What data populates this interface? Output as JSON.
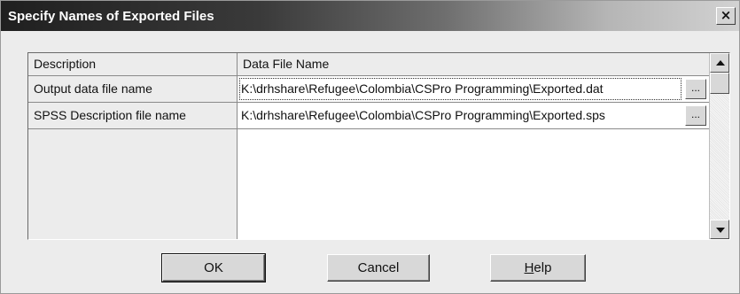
{
  "window": {
    "title": "Specify Names of Exported Files",
    "close_label": "×"
  },
  "grid": {
    "columns": [
      "Description",
      "Data File Name"
    ],
    "rows": [
      {
        "description": "Output data file name",
        "file": "K:\\drhshare\\Refugee\\Colombia\\CSPro Programming\\Exported.dat",
        "browse_label": "..."
      },
      {
        "description": "SPSS Description file name",
        "file": "K:\\drhshare\\Refugee\\Colombia\\CSPro Programming\\Exported.sps",
        "browse_label": "..."
      }
    ]
  },
  "buttons": {
    "ok": "OK",
    "cancel": "Cancel",
    "help_hotkey": "H",
    "help_rest": "elp"
  },
  "icons": {
    "scroll_up": "triangle-up-icon",
    "scroll_down": "triangle-down-icon"
  }
}
